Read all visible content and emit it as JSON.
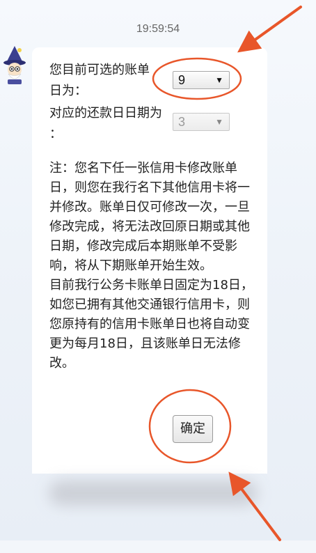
{
  "chat": {
    "timestamp": "19:59:54"
  },
  "form": {
    "billing_day_label": "您目前可选的账单日为：",
    "billing_day_value": "9",
    "repayment_day_label": "对应的还款日日期为 ：",
    "repayment_day_value": "3"
  },
  "notice": {
    "paragraph1": "注：您名下任一张信用卡修改账单日，则您在我行名下其他信用卡将一并修改。账单日仅可修改一次，一旦修改完成，将无法改回原日期或其他日期，修改完成后本期账单不受影响，将从下期账单开始生效。",
    "paragraph2": "目前我行公务卡账单日固定为18日，如您已拥有其他交通银行信用卡，则您原持有的信用卡账单日也将自动变更为每月18日，且该账单日无法修改。"
  },
  "actions": {
    "confirm_label": "确定"
  },
  "annotations": {
    "highlight_color": "#e8562a"
  },
  "icons": {
    "avatar": "wizard-avatar-icon",
    "dropdown": "triangle-down-icon"
  }
}
